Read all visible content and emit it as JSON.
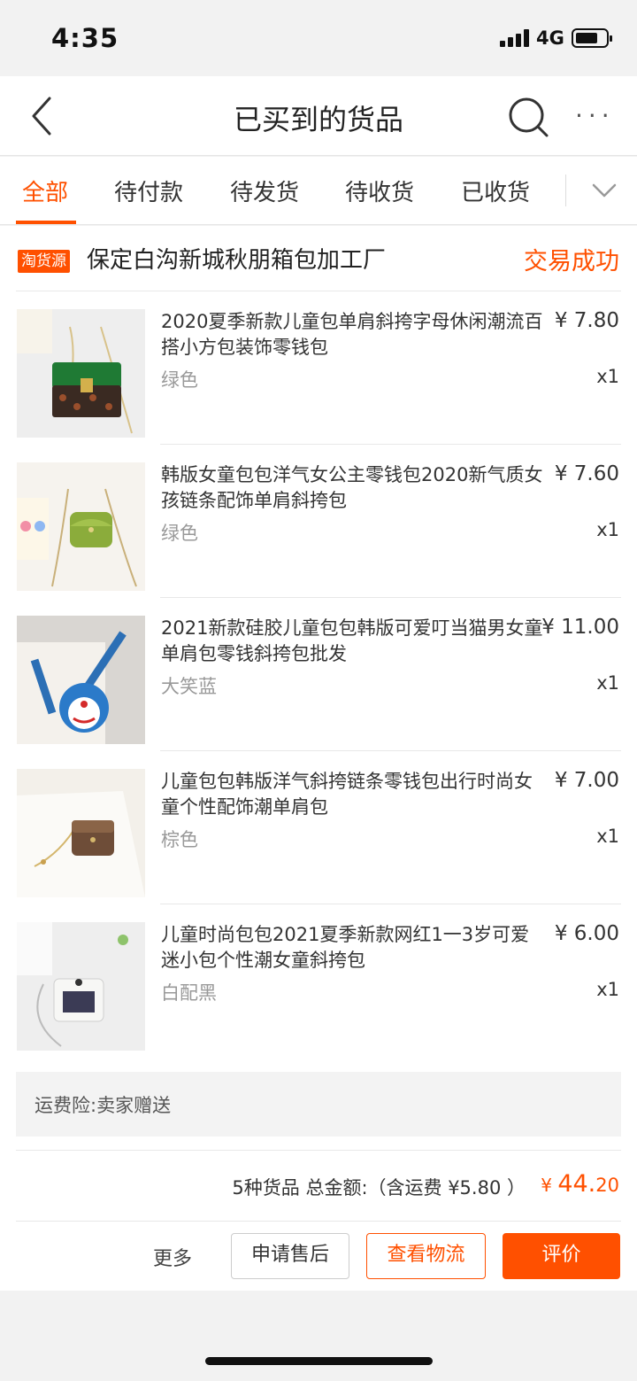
{
  "status_bar": {
    "time": "4:35",
    "network": "4G",
    "battery_level": 0.75,
    "signal_bars": 4
  },
  "nav": {
    "title": "已买到的货品",
    "back_icon": "chevron-left-icon",
    "search_icon": "search-icon",
    "more_icon": "ellipsis-icon",
    "more_glyph": "···"
  },
  "tabs": {
    "items": [
      {
        "label": "全部",
        "active": true
      },
      {
        "label": "待付款",
        "active": false
      },
      {
        "label": "待发货",
        "active": false
      },
      {
        "label": "待收货",
        "active": false
      },
      {
        "label": "已收货",
        "active": false
      }
    ],
    "expand_icon": "chevron-down-icon"
  },
  "order": {
    "shop_tag": "淘货源",
    "shop_name": "保定白沟新城秋朋箱包加工厂",
    "status": "交易成功",
    "items": [
      {
        "title": "2020夏季新款儿童包单肩斜挎字母休闲潮流百搭小方包装饰零钱包",
        "price": "¥ 7.80",
        "variant": "绿色",
        "qty": "x1"
      },
      {
        "title": "韩版女童包包洋气女公主零钱包2020新气质女孩链条配饰单肩斜挎包",
        "price": "¥ 7.60",
        "variant": "绿色",
        "qty": "x1"
      },
      {
        "title": "2021新款硅胶儿童包包韩版可爱叮当猫男女童单肩包零钱斜挎包批发",
        "price": "¥ 11.00",
        "variant": "大笑蓝",
        "qty": "x1"
      },
      {
        "title": "儿童包包韩版洋气斜挎链条零钱包出行时尚女童个性配饰潮单肩包",
        "price": "¥ 7.00",
        "variant": "棕色",
        "qty": "x1"
      },
      {
        "title": "儿童时尚包包2021夏季新款网红1一3岁可爱迷小包个性潮女童斜挎包",
        "price": "¥ 6.00",
        "variant": "白配黑",
        "qty": "x1"
      }
    ],
    "insurance": "运费险:卖家赠送",
    "summary": "5种货品 总金额:（含运费 ¥5.80 ）",
    "total_currency": "¥ ",
    "total_int": "44.",
    "total_dec": "20"
  },
  "actions": {
    "more": "更多",
    "after_sale": "申请售后",
    "logistics": "查看物流",
    "review": "评价"
  },
  "colors": {
    "accent": "#ff5000",
    "background": "#f2f2f2"
  }
}
